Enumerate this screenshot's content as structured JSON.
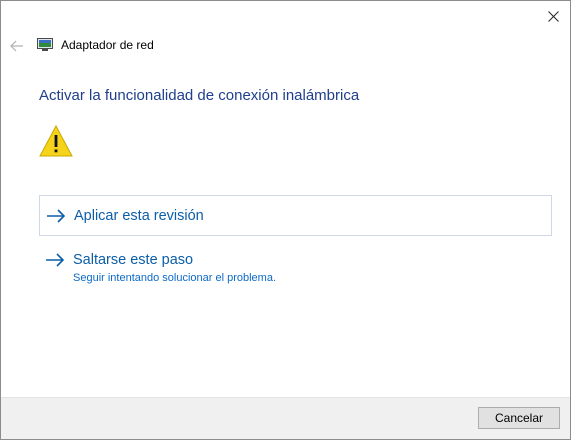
{
  "window": {
    "app_title": "Adaptador de red",
    "app_icon": "network-adapter-icon",
    "close_icon": "close-icon",
    "back_icon": "back-arrow-icon"
  },
  "main": {
    "title": "Activar la funcionalidad de conexión inalámbrica",
    "status_icon": "warning-icon",
    "options": [
      {
        "label": "Aplicar esta revisión",
        "icon": "arrow-right-icon"
      },
      {
        "label": "Saltarse este paso",
        "description": "Seguir intentando solucionar el problema.",
        "icon": "arrow-right-icon"
      }
    ]
  },
  "footer": {
    "cancel_label": "Cancelar"
  },
  "colors": {
    "title": "#1f3f8c",
    "link": "#0c5ea8",
    "warning_fill": "#f5d31a",
    "footer_bg": "#f0f0f0"
  }
}
